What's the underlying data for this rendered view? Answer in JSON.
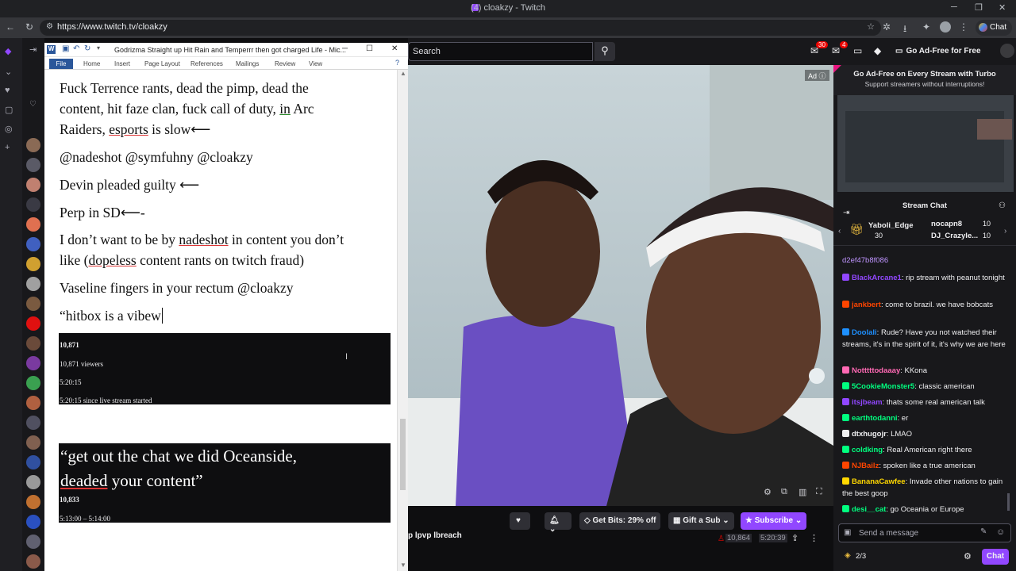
{
  "browser": {
    "tab_title": "(4) cloakzy - Twitch",
    "url": "https://www.twitch.tv/cloakzy",
    "chat_label": "Chat"
  },
  "word": {
    "title": "Godrizma Straight up Hit Rain and Temperrr then got charged Life - Mic...",
    "tabs": [
      "File",
      "Home",
      "Insert",
      "Page Layout",
      "References",
      "Mailings",
      "Review",
      "View"
    ],
    "paragraphs": {
      "p1a": "Fuck Terrence rants, dead the pimp, dead the",
      "p1b_pre": "content, hit faze clan, fuck call of duty, ",
      "p1b_in": "in",
      "p1b_post": " Arc",
      "p1c_pre": "Raiders, ",
      "p1c_u": "esports",
      "p1c_post": " is slow",
      "p2": "@nadeshot @symfuhny @cloakzy",
      "p3": "Devin pleaded guilty ",
      "p4": "Perp in SD",
      "p4_tail": "-",
      "p5a_pre": "I don’t want to be by ",
      "p5a_u": "nadeshot",
      "p5a_post": " in content you don’t",
      "p5b_pre": "like (",
      "p5b_u": "dopeless",
      "p5b_post": " content rants on twitch fraud)",
      "p6": "Vaseline fingers in your rectum @cloakzy",
      "p7": "“hitbox is a vibew"
    },
    "arrow": "⟵",
    "block1": {
      "viewers": "10,871",
      "viewers_label": "10,871 viewers",
      "uptime": "5:20:15",
      "uptime_label": "5:20:15 since live stream started"
    },
    "block2": {
      "quote1": "“get out the chat we did Oceanside,",
      "quote2_u": "deaded",
      "quote2_post": " your content”",
      "viewers": "10,833",
      "range": "5:13:00 – 5:14:00"
    }
  },
  "twitch": {
    "search_placeholder": "Search",
    "notif_count": "30",
    "whisper_count": "4",
    "ad_free": "Go Ad-Free for Free",
    "ad_label": "Ad",
    "turbo_title": "Go Ad-Free on Every Stream with Turbo",
    "turbo_sub": "Support streamers without interruptions!",
    "stream_chat": "Stream Chat",
    "gifters": [
      {
        "name": "Yaboli_Edge",
        "count": "30"
      },
      {
        "name": "nocapn8",
        "count": "10"
      },
      {
        "name": "DJ_Crazyle...",
        "count": "10"
      }
    ],
    "chat_top_line": "d2ef47b8f086",
    "messages": [
      {
        "user": "BlackArcane1",
        "color": "#9147ff",
        "text": "rip stream with peanut tonight"
      },
      {
        "user": "jankbert",
        "color": "#ff4500",
        "text": "come to brazil. we have bobcats"
      },
      {
        "user": "Doolali",
        "color": "#1e90ff",
        "text": "Rude? Have you not watched their streams, it's in the spirit of it, it's why we are here"
      },
      {
        "user": "Notttttodaaay",
        "color": "#ff69b4",
        "text": "KKona"
      },
      {
        "user": "5CookieMonster5",
        "color": "#00ff7f",
        "text": "classic american"
      },
      {
        "user": "itsjbeam",
        "color": "#9147ff",
        "text": "thats some real american talk"
      },
      {
        "user": "earthtodanni",
        "color": "#00ff7f",
        "text": "er"
      },
      {
        "user": "dtxhugojr",
        "color": "#efeff1",
        "text": "LMAO"
      },
      {
        "user": "coldking",
        "color": "#00ff7f",
        "text": "Real American right there"
      },
      {
        "user": "NJBailz",
        "color": "#ff4500",
        "text": "spoken like a true american"
      },
      {
        "user": "BananaCawfee",
        "color": "#ffd700",
        "text": "Invade other nations to gain the best goop"
      },
      {
        "user": "desi__cat",
        "color": "#00ff7f",
        "text": "go Oceania or Europe"
      }
    ],
    "send_placeholder": "Send a message",
    "points": "2/3",
    "chat_button": "Chat",
    "get_bits": "Get Bits: 29% off",
    "gift_sub": "Gift a Sub",
    "subscribe": "Subscribe",
    "stream_tags": "p lpvp lbreach",
    "viewer_count": "10,864",
    "uptime": "5:20:39"
  }
}
